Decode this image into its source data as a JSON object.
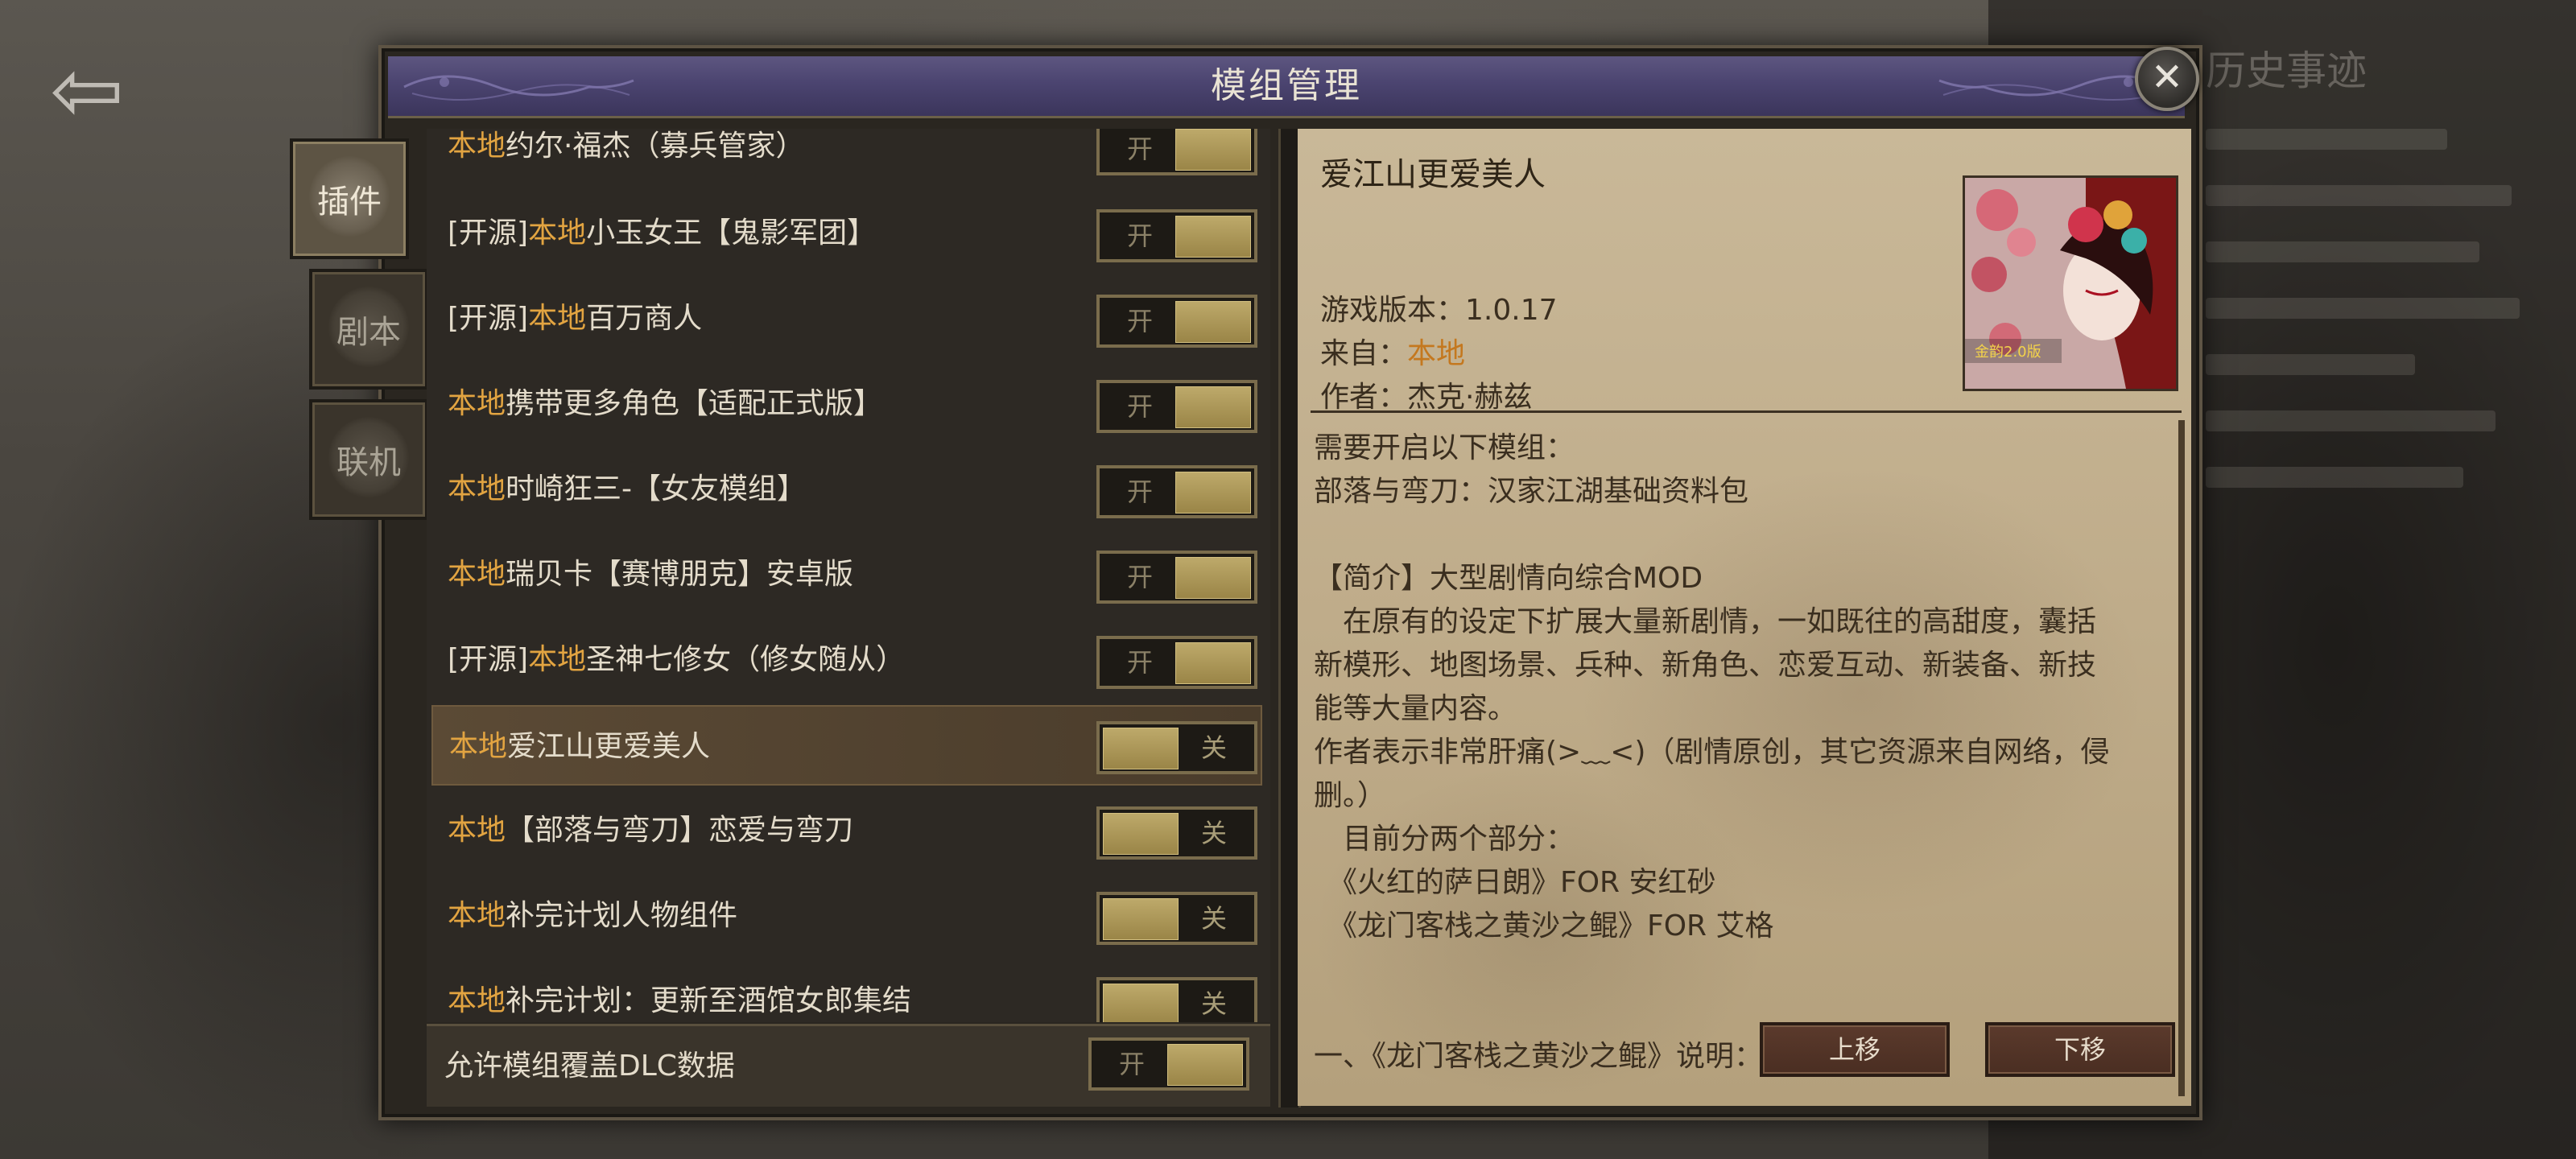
{
  "background": {
    "right_panel_title": "历史事迹",
    "back_icon": "arrow-left-icon"
  },
  "dialog": {
    "title": "模组管理",
    "close_icon": "close-icon"
  },
  "side_tabs": [
    {
      "label": "插件",
      "active": true
    },
    {
      "label": "剧本",
      "active": false
    },
    {
      "label": "联机",
      "active": false
    }
  ],
  "mod_list": [
    {
      "prefix": "",
      "local": "本地",
      "name": "约尔·福杰（募兵管家）",
      "state": "开",
      "enabled": true
    },
    {
      "prefix": "[开源]",
      "local": "本地",
      "name": "小玉女王【鬼影军团】",
      "state": "开",
      "enabled": true
    },
    {
      "prefix": "[开源]",
      "local": "本地",
      "name": "百万商人",
      "state": "开",
      "enabled": true
    },
    {
      "prefix": "",
      "local": "本地",
      "name": "携带更多角色【适配正式版】",
      "state": "开",
      "enabled": true
    },
    {
      "prefix": "",
      "local": "本地",
      "name": "时崎狂三-【女友模组】",
      "state": "开",
      "enabled": true
    },
    {
      "prefix": "",
      "local": "本地",
      "name": "瑞贝卡【赛博朋克】安卓版",
      "state": "开",
      "enabled": true
    },
    {
      "prefix": "[开源]",
      "local": "本地",
      "name": "圣神七修女（修女随从）",
      "state": "开",
      "enabled": true
    },
    {
      "prefix": "",
      "local": "本地",
      "name": "爱江山更爱美人",
      "state": "关",
      "enabled": false,
      "selected": true
    },
    {
      "prefix": "",
      "local": "本地",
      "name": "【部落与弯刀】恋爱与弯刀",
      "state": "关",
      "enabled": false
    },
    {
      "prefix": "",
      "local": "本地",
      "name": "补完计划人物组件",
      "state": "关",
      "enabled": false
    },
    {
      "prefix": "",
      "local": "本地",
      "name": "补完计划：更新至酒馆女郎集结",
      "state": "关",
      "enabled": false
    }
  ],
  "bottom_option": {
    "label": "允许模组覆盖DLC数据",
    "state": "开",
    "enabled": true
  },
  "detail": {
    "title": "爱江山更爱美人",
    "cover_caption": "金韵2.0版",
    "version_label": "游戏版本：",
    "version": "1.0.17",
    "source_label": "来自：",
    "source": "本地",
    "author_label": "作者：",
    "author": "杰克·赫兹",
    "body": [
      "需要开启以下模组：",
      "部落与弯刀：汉家江湖基础资料包",
      "",
      "【简介】大型剧情向综合MOD",
      "　在原有的设定下扩展大量新剧情，一如既往的高甜度，囊括",
      "新模形、地图场景、兵种、新角色、恋爱互动、新装备、新技",
      "能等大量内容。",
      "作者表示非常肝痛(>﹏<)（剧情原创，其它资源来自网络，侵",
      "删。）",
      "　目前分两个部分：",
      "　《火红的萨日朗》FOR 安红砂",
      "　《龙门客栈之黄沙之鲲》FOR 艾格",
      "",
      "",
      "一、《龙门客栈之黄沙之鲲》说明："
    ],
    "move_up": "上移",
    "move_down": "下移"
  }
}
